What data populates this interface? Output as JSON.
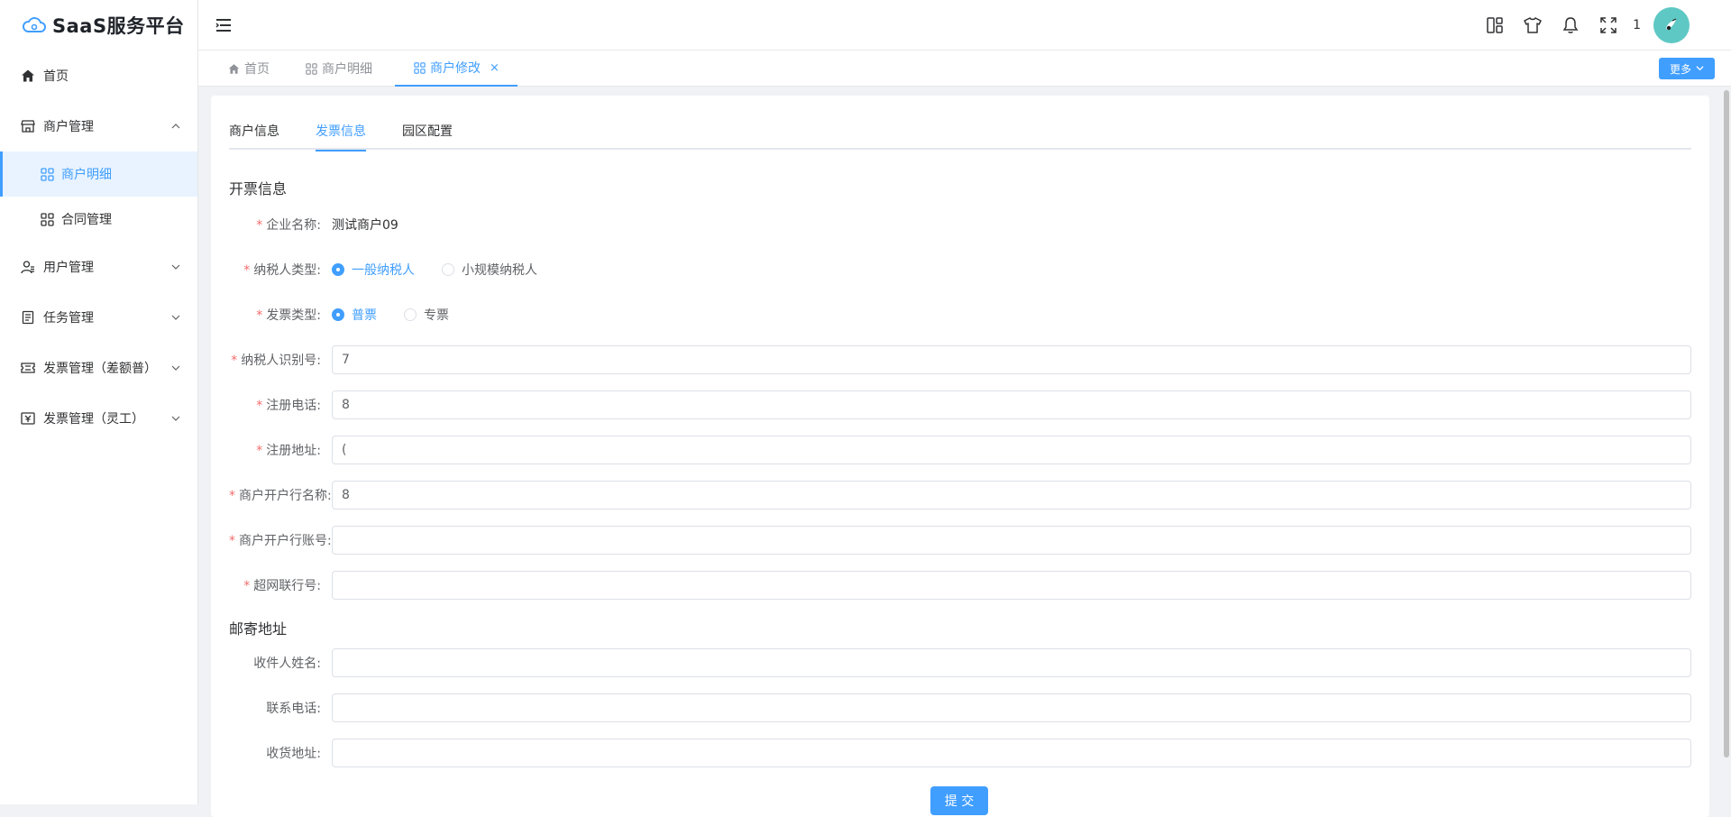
{
  "app": {
    "title": "SaaS服务平台"
  },
  "sidebar": {
    "items": [
      {
        "label": "首页",
        "icon": "home-icon"
      },
      {
        "label": "商户管理",
        "icon": "shop-icon",
        "expanded": true,
        "children": [
          {
            "label": "商户明细",
            "icon": "grid-icon",
            "active": true
          },
          {
            "label": "合同管理",
            "icon": "grid-icon"
          }
        ]
      },
      {
        "label": "用户管理",
        "icon": "user-icon"
      },
      {
        "label": "任务管理",
        "icon": "task-icon"
      },
      {
        "label": "发票管理（差额普）",
        "icon": "ticket-icon"
      },
      {
        "label": "发票管理（灵工）",
        "icon": "invoice-icon"
      }
    ]
  },
  "header": {
    "notification_count": "1"
  },
  "tags": [
    {
      "label": "首页",
      "icon": "home-icon"
    },
    {
      "label": "商户明细",
      "icon": "grid-icon"
    },
    {
      "label": "商户修改",
      "icon": "grid-icon",
      "active": true,
      "close": "×"
    }
  ],
  "more_button": "更多",
  "page_tabs": [
    {
      "label": "商户信息"
    },
    {
      "label": "发票信息",
      "active": true
    },
    {
      "label": "园区配置"
    }
  ],
  "invoice_section": {
    "title": "开票信息",
    "company_name": {
      "label": "企业名称:",
      "value": "测试商户09"
    },
    "taxpayer_type": {
      "label": "纳税人类型:",
      "options": [
        "一般纳税人",
        "小规模纳税人"
      ],
      "selected": "一般纳税人"
    },
    "invoice_type": {
      "label": "发票类型:",
      "options": [
        "普票",
        "专票"
      ],
      "selected": "普票"
    },
    "tax_id": {
      "label": "纳税人识别号:",
      "value": "7"
    },
    "reg_phone": {
      "label": "注册电话:",
      "value": "8"
    },
    "reg_address": {
      "label": "注册地址:",
      "value": "("
    },
    "bank_name": {
      "label": "商户开户行名称:",
      "value": "8"
    },
    "bank_account": {
      "label": "商户开户行账号:",
      "value": ""
    },
    "swift_no": {
      "label": "超网联行号:",
      "value": ""
    }
  },
  "mail_section": {
    "title": "邮寄地址",
    "recipient": {
      "label": "收件人姓名:",
      "value": ""
    },
    "phone": {
      "label": "联系电话:",
      "value": ""
    },
    "address": {
      "label": "收货地址:",
      "value": ""
    }
  },
  "submit_label": "提 交",
  "colors": {
    "primary": "#409eff",
    "required": "#f56c6c",
    "avatar": "#5ec8c4"
  }
}
